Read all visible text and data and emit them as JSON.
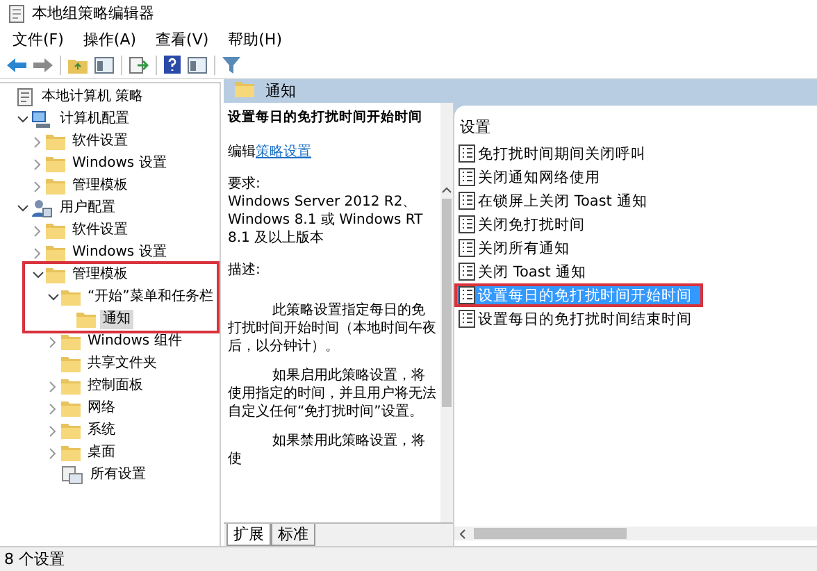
{
  "window": {
    "title": "本地组策略编辑器"
  },
  "menu": [
    "文件(F)",
    "操作(A)",
    "查看(V)",
    "帮助(H)"
  ],
  "toolbar": [
    {
      "kind": "back"
    },
    {
      "kind": "forward"
    },
    {
      "kind": "sep"
    },
    {
      "kind": "folder-up"
    },
    {
      "kind": "panel"
    },
    {
      "kind": "sep"
    },
    {
      "kind": "export"
    },
    {
      "kind": "sep"
    },
    {
      "kind": "help"
    },
    {
      "kind": "panel"
    },
    {
      "kind": "sep"
    },
    {
      "kind": "filter"
    }
  ],
  "tree": [
    {
      "label": "本地计算机 策略",
      "kind": "policy",
      "selected": false,
      "children": [
        {
          "label": "计算机配置",
          "kind": "computer",
          "expanded": true,
          "selected": false,
          "children": [
            {
              "label": "软件设置",
              "kind": "folder",
              "expanded": false,
              "selected": false
            },
            {
              "label": "Windows 设置",
              "kind": "folder",
              "expanded": false,
              "selected": false
            },
            {
              "label": "管理模板",
              "kind": "folder",
              "expanded": false,
              "selected": false
            }
          ]
        },
        {
          "label": "用户配置",
          "kind": "user",
          "expanded": true,
          "selected": false,
          "children": [
            {
              "label": "软件设置",
              "kind": "folder",
              "expanded": false,
              "selected": false
            },
            {
              "label": "Windows 设置",
              "kind": "folder",
              "expanded": false,
              "selected": false
            },
            {
              "label": "管理模板",
              "kind": "folder",
              "expanded": true,
              "selected": false,
              "highlighted": true,
              "children": [
                {
                  "label": "“开始”菜单和任务栏",
                  "kind": "folder",
                  "expanded": true,
                  "selected": false,
                  "children": [
                    {
                      "label": "通知",
                      "kind": "folder",
                      "selected": true
                    }
                  ]
                },
                {
                  "label": "Windows 组件",
                  "kind": "folder",
                  "expanded": false,
                  "selected": false
                },
                {
                  "label": "共享文件夹",
                  "kind": "folder",
                  "selected": false
                },
                {
                  "label": "控制面板",
                  "kind": "folder",
                  "expanded": false,
                  "selected": false
                },
                {
                  "label": "网络",
                  "kind": "folder",
                  "expanded": false,
                  "selected": false
                },
                {
                  "label": "系统",
                  "kind": "folder",
                  "expanded": false,
                  "selected": false
                },
                {
                  "label": "桌面",
                  "kind": "folder",
                  "expanded": false,
                  "selected": false
                },
                {
                  "label": "所有设置",
                  "kind": "settings",
                  "selected": false
                }
              ]
            }
          ]
        }
      ]
    }
  ],
  "pane_header": {
    "title": "通知"
  },
  "detail": {
    "title": "设置每日的免打扰时间开始时间",
    "edit_prefix": "编辑",
    "edit_link": "策略设置",
    "requirements_label": "要求:",
    "requirements": "Windows Server 2012 R2、Windows 8.1 或 Windows RT 8.1 及以上版本",
    "description_label": "描述:",
    "paragraphs": [
      "此策略设置指定每日的免打扰时间开始时间（本地时间午夜后，以分钟计）。",
      "如果启用此策略设置，将使用指定的时间，并且用户将无法自定义任何“免打扰时间”设置。",
      "如果禁用此策略设置，将使"
    ]
  },
  "list": {
    "column": "设置",
    "items": [
      {
        "label": "免打扰时间期间关闭呼叫",
        "selected": false,
        "highlighted": false
      },
      {
        "label": "关闭通知网络使用",
        "selected": false,
        "highlighted": false
      },
      {
        "label": "在锁屏上关闭 Toast 通知",
        "selected": false,
        "highlighted": false
      },
      {
        "label": "关闭免打扰时间",
        "selected": false,
        "highlighted": false
      },
      {
        "label": "关闭所有通知",
        "selected": false,
        "highlighted": false
      },
      {
        "label": "关闭 Toast 通知",
        "selected": false,
        "highlighted": false
      },
      {
        "label": "设置每日的免打扰时间开始时间",
        "selected": true,
        "highlighted": true
      },
      {
        "label": "设置每日的免打扰时间结束时间",
        "selected": false,
        "highlighted": false
      }
    ]
  },
  "tabs": [
    {
      "label": "扩展",
      "selected": true
    },
    {
      "label": "标准",
      "selected": false
    }
  ],
  "status_bar": {
    "text": "8 个设置"
  }
}
